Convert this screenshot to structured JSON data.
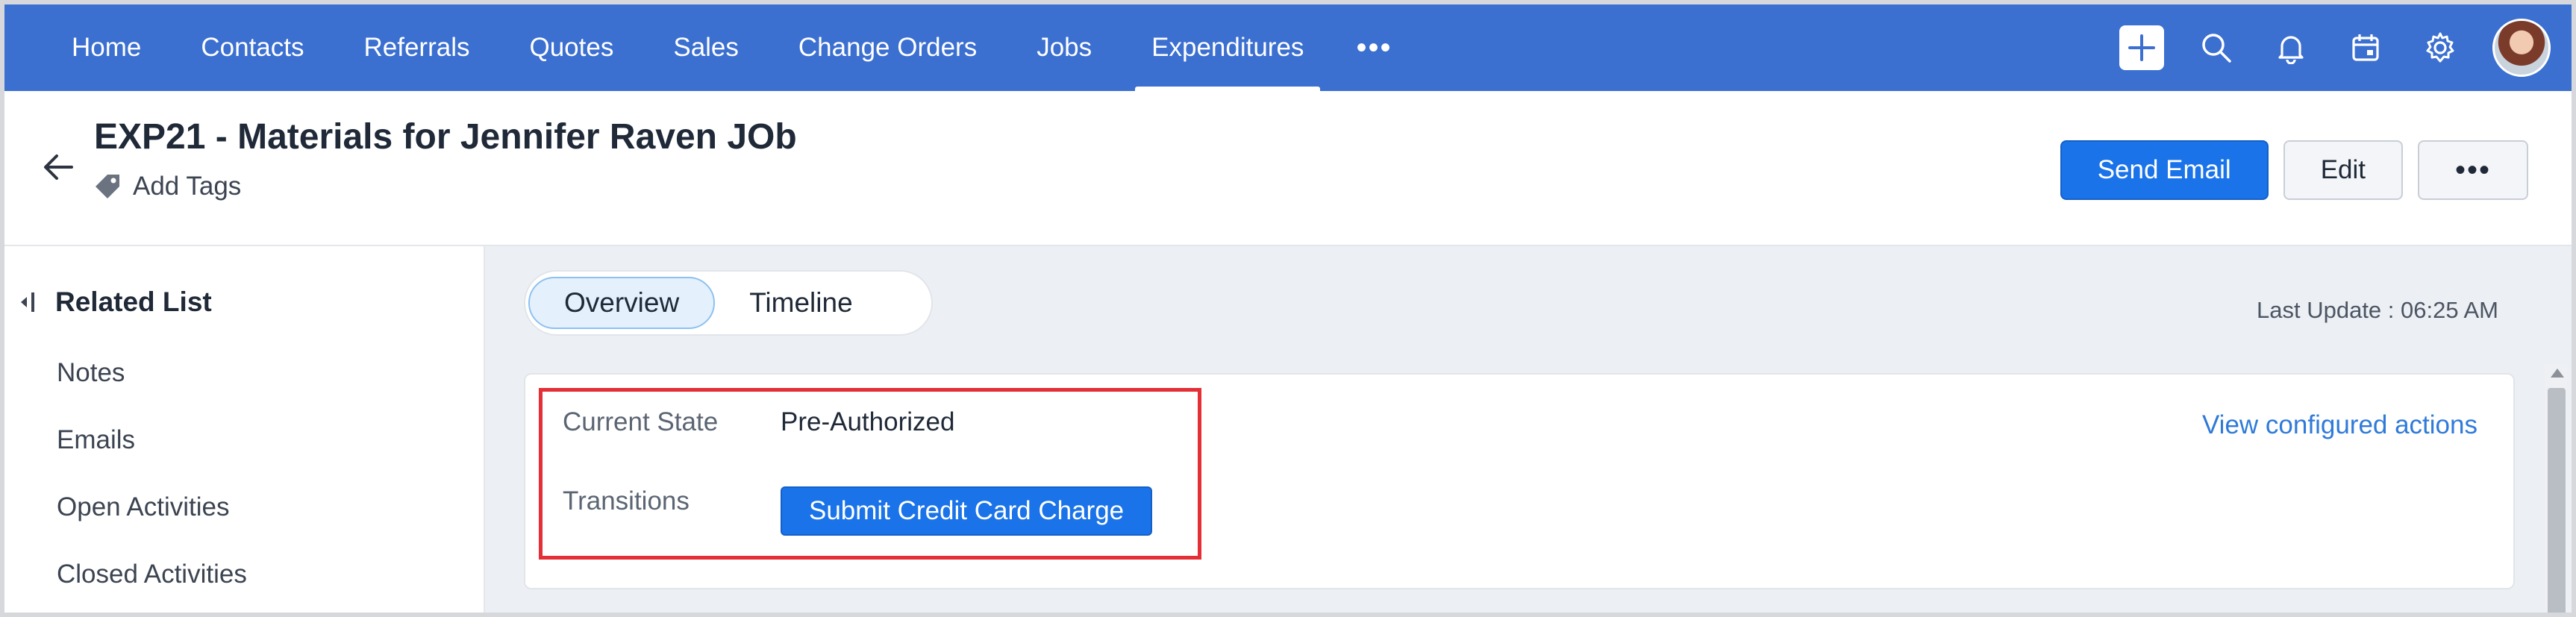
{
  "nav": {
    "tabs": [
      {
        "label": "Home",
        "active": false
      },
      {
        "label": "Contacts",
        "active": false
      },
      {
        "label": "Referrals",
        "active": false
      },
      {
        "label": "Quotes",
        "active": false
      },
      {
        "label": "Sales",
        "active": false
      },
      {
        "label": "Change Orders",
        "active": false
      },
      {
        "label": "Jobs",
        "active": false
      },
      {
        "label": "Expenditures",
        "active": true
      }
    ],
    "more_label": "•••",
    "icons": [
      "plus-icon",
      "search-icon",
      "bell-icon",
      "calendar-icon",
      "gear-icon",
      "avatar"
    ]
  },
  "record": {
    "title": "EXP21 - Materials for Jennifer Raven JOb",
    "add_tags_label": "Add Tags",
    "actions": {
      "send_email": "Send Email",
      "edit": "Edit",
      "more": "•••"
    }
  },
  "sidebar": {
    "title": "Related List",
    "items": [
      "Notes",
      "Emails",
      "Open Activities",
      "Closed Activities"
    ]
  },
  "main": {
    "tabs": [
      {
        "label": "Overview",
        "active": true
      },
      {
        "label": "Timeline",
        "active": false
      }
    ],
    "last_update": "Last Update : 06:25 AM",
    "blueprint": {
      "current_state_label": "Current State",
      "current_state_value": "Pre-Authorized",
      "transitions_label": "Transitions",
      "transition_button": "Submit Credit Card Charge",
      "view_actions_link": "View configured actions"
    }
  },
  "colors": {
    "nav_bg": "#3b6fd0",
    "primary": "#1a73e8",
    "highlight_border": "#e32f35",
    "link": "#2f7ad9",
    "main_bg": "#eceff3"
  }
}
